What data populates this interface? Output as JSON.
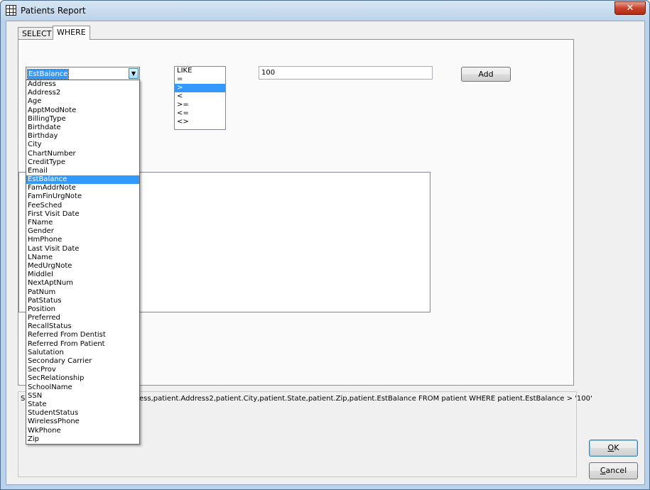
{
  "window": {
    "title": "Patients Report",
    "close_label": "✕"
  },
  "tabs": [
    {
      "label": "SELECT"
    },
    {
      "label": "WHERE"
    }
  ],
  "where": {
    "field_combo": {
      "selected": "EstBalance",
      "arrow": "▼"
    },
    "operators": [
      "LIKE",
      "=",
      ">",
      "<",
      ">=",
      "<=",
      "<>"
    ],
    "selected_operator_index": 2,
    "value": "100",
    "add_label": "Add",
    "field_options": [
      "Address",
      "Address2",
      "Age",
      "ApptModNote",
      "BillingType",
      "Birthdate",
      "Birthday",
      "City",
      "ChartNumber",
      "CreditType",
      "Email",
      "EstBalance",
      "FamAddrNote",
      "FamFinUrgNote",
      "FeeSched",
      "First Visit Date",
      "FName",
      "Gender",
      "HmPhone",
      "Last Visit Date",
      "LName",
      "MedUrgNote",
      "MiddleI",
      "NextAptNum",
      "PatNum",
      "PatStatus",
      "Position",
      "Preferred",
      "RecallStatus",
      "Referred From Dentist",
      "Referred From Patient",
      "Salutation",
      "Secondary Carrier",
      "SecProv",
      "SecRelationship",
      "SchoolName",
      "SSN",
      "State",
      "StudentStatus",
      "WirelessPhone",
      "WkPhone",
      "Zip"
    ],
    "selected_option_index": 11
  },
  "sql": {
    "prefix": "S",
    "visible_text": "ess,patient.Address2,patient.City,patient.State,patient.Zip,patient.EstBalance FROM patient WHERE patient.EstBalance > '100'"
  },
  "buttons": {
    "ok": {
      "mnemonic": "O",
      "rest": "K"
    },
    "cancel": {
      "mnemonic": "C",
      "rest": "ancel"
    }
  },
  "colors": {
    "selection": "#3399ff",
    "titlebar": "#bcd3ea",
    "close_button": "#c7432d"
  }
}
